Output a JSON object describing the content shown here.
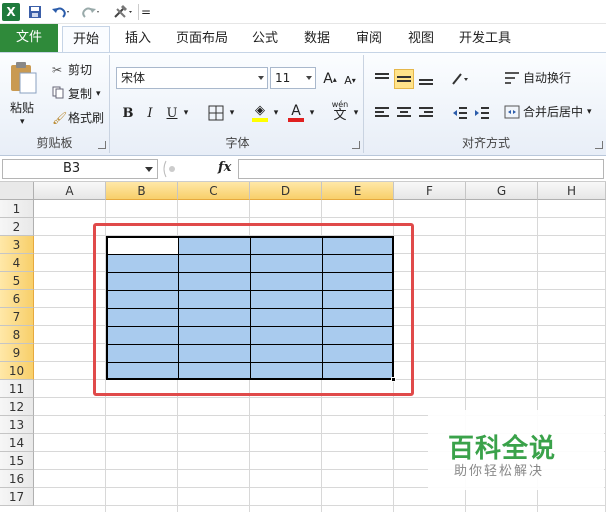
{
  "app": {
    "logo_letter": "X",
    "qat_overflow": "="
  },
  "ribbon_tabs": [
    "文件",
    "开始",
    "插入",
    "页面布局",
    "公式",
    "数据",
    "审阅",
    "视图",
    "开发工具"
  ],
  "clipboard": {
    "paste_label": "粘贴",
    "cut_label": "剪切",
    "copy_label": "复制",
    "format_painter_label": "格式刷",
    "group_label": "剪贴板"
  },
  "font": {
    "font_name": "宋体",
    "font_size": "11",
    "grow_label": "A",
    "shrink_label": "A",
    "bold": "B",
    "italic": "I",
    "underline": "U",
    "phonetic": "wén",
    "phonetic_char": "文",
    "group_label": "字体"
  },
  "alignment": {
    "wrap_text_label": "自动换行",
    "merge_center_label": "合并后居中",
    "group_label": "对齐方式"
  },
  "formula_bar": {
    "name_box": "B3",
    "fx_label": "fx",
    "formula": ""
  },
  "columns": [
    "A",
    "B",
    "C",
    "D",
    "E",
    "F",
    "G",
    "H"
  ],
  "rows": [
    "1",
    "2",
    "3",
    "4",
    "5",
    "6",
    "7",
    "8",
    "9",
    "10",
    "11",
    "12",
    "13",
    "14",
    "15",
    "16",
    "17"
  ],
  "watermark": {
    "title": "百科全说",
    "subtitle": "助你轻松解决"
  },
  "colors": {
    "file_tab": "#2f8a3a",
    "selection_fill": "#a9cbee",
    "highlight_box": "#e04a4a",
    "header_selected": "#f8cf6a"
  }
}
